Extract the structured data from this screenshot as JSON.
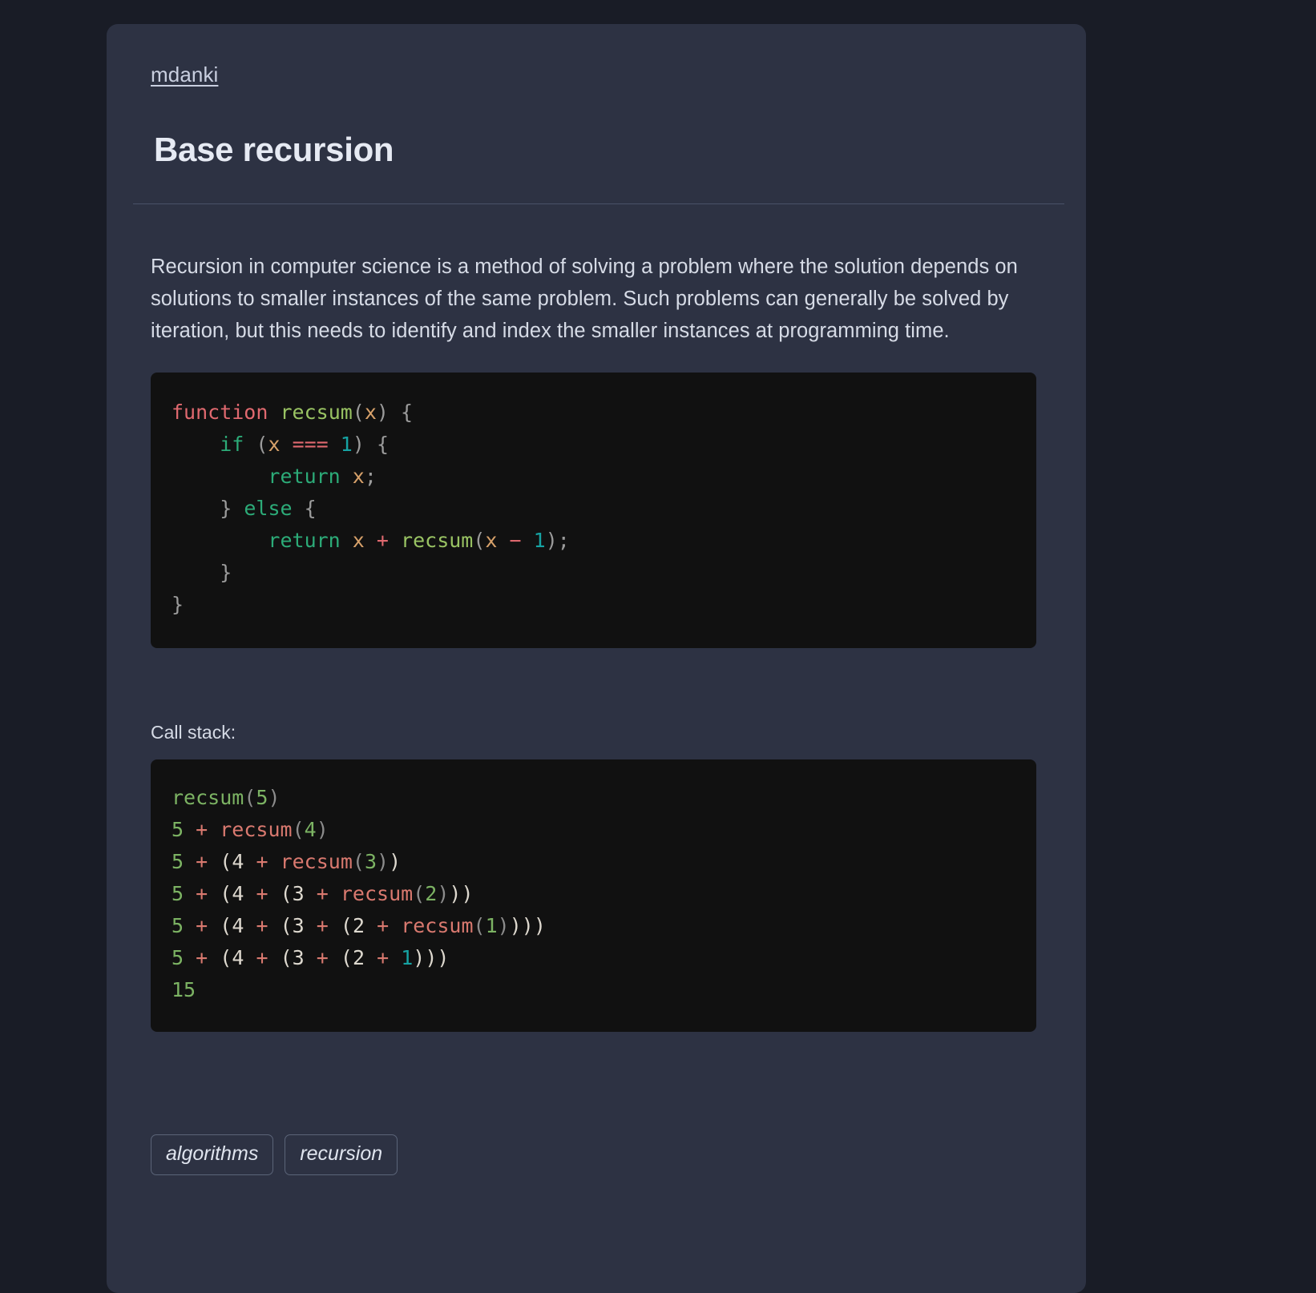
{
  "breadcrumb": {
    "label": "mdanki"
  },
  "header": {
    "title": "Base recursion"
  },
  "content": {
    "paragraph": "Recursion in computer science is a method of solving a problem where the solution depends on solutions to smaller instances of the same problem. Such problems can generally be solved by iteration, but this needs to identify and index the smaller instances at programming time.",
    "call_stack_label": "Call stack:"
  },
  "code": {
    "language": "javascript",
    "raw": "function recsum(x) {\n    if (x === 1) {\n        return x;\n    } else {\n        return x + recsum(x - 1);\n    }\n}",
    "tokens": {
      "kw_function": "function",
      "fn_name": "recsum",
      "paren_open": "(",
      "paren_close": ")",
      "param_x": "x",
      "brace_open": "{",
      "brace_close": "}",
      "kw_if": "if",
      "op_eq": "===",
      "num_one": "1",
      "kw_return": "return",
      "kw_else": "else",
      "op_plus": "+",
      "op_minus": "−",
      "semicolon": ";"
    }
  },
  "call_stack": {
    "raw": "recsum(5)\n5 + recsum(4)\n5 + (4 + recsum(3))\n5 + (4 + (3 + recsum(2)))\n5 + (4 + (3 + (2 + recsum(1))))\n5 + (4 + (3 + (2 + 1)))\n15",
    "lines": [
      "recsum(5)",
      "5 + recsum(4)",
      "5 + (4 + recsum(3))",
      "5 + (4 + (3 + recsum(2)))",
      "5 + (4 + (3 + (2 + recsum(1))))",
      "5 + (4 + (3 + (2 + 1)))",
      "15"
    ],
    "result": "15"
  },
  "tags": [
    {
      "label": "algorithms"
    },
    {
      "label": "recursion"
    }
  ],
  "colors": {
    "page_background": "#191c26",
    "card_background": "#2d3243",
    "code_background": "#111111",
    "title_text": "#e6eaf3",
    "body_text": "#d6dbe6",
    "link_text": "#c9cfe0",
    "divider": "#4a5268",
    "syntax_keyword": "#e0696f",
    "syntax_function": "#99c363",
    "syntax_param": "#d7a16a",
    "syntax_control": "#2cab78",
    "syntax_number": "#16a3a3",
    "syntax_punctuation": "#9b9b9b",
    "stack_green": "#7cb363",
    "stack_salmon": "#d9796f",
    "stack_cream": "#ded9cf",
    "tag_border": "#5b6478"
  }
}
